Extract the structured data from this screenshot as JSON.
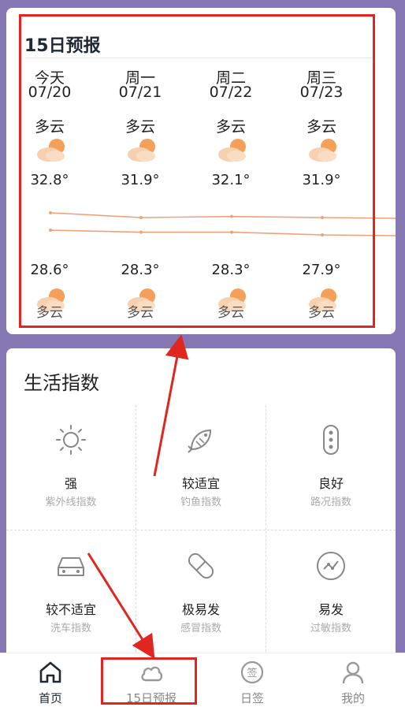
{
  "forecast": {
    "title": "15日预报",
    "days": [
      {
        "name": "今天",
        "date": "07/20",
        "weather": "多云",
        "high": "32.8°",
        "low": "28.6°",
        "night_weather": "多云"
      },
      {
        "name": "周一",
        "date": "07/21",
        "weather": "多云",
        "high": "31.9°",
        "low": "28.3°",
        "night_weather": "多云"
      },
      {
        "name": "周二",
        "date": "07/22",
        "weather": "多云",
        "high": "32.1°",
        "low": "28.3°",
        "night_weather": "多云"
      },
      {
        "name": "周三",
        "date": "07/23",
        "weather": "多云",
        "high": "31.9°",
        "low": "27.9°",
        "night_weather": "多云"
      }
    ],
    "high_temps": [
      32.8,
      31.9,
      32.1,
      31.9
    ],
    "low_temps": [
      28.6,
      28.3,
      28.3,
      27.9
    ],
    "line_color": "#f0a07a"
  },
  "life": {
    "title": "生活指数",
    "items": [
      {
        "value": "强",
        "label": "紫外线指数",
        "icon": "sun-icon"
      },
      {
        "value": "较适宜",
        "label": "钓鱼指数",
        "icon": "fish-icon"
      },
      {
        "value": "良好",
        "label": "路况指数",
        "icon": "traffic-light-icon"
      },
      {
        "value": "较不适宜",
        "label": "洗车指数",
        "icon": "car-icon"
      },
      {
        "value": "极易发",
        "label": "感冒指数",
        "icon": "pill-icon"
      },
      {
        "value": "易发",
        "label": "过敏指数",
        "icon": "allergy-icon"
      }
    ]
  },
  "tabs": [
    {
      "label": "首页",
      "icon": "home-icon",
      "active": true
    },
    {
      "label": "15日预报",
      "icon": "cloud-icon",
      "active": false
    },
    {
      "label": "日签",
      "icon": "sign-icon",
      "active": false,
      "badge": "签"
    },
    {
      "label": "我的",
      "icon": "user-icon",
      "active": false
    }
  ],
  "colors": {
    "background": "#8576b4",
    "highlight": "#e0261f",
    "sun": "#f5a05a",
    "cloud": "#f7d0b0"
  }
}
